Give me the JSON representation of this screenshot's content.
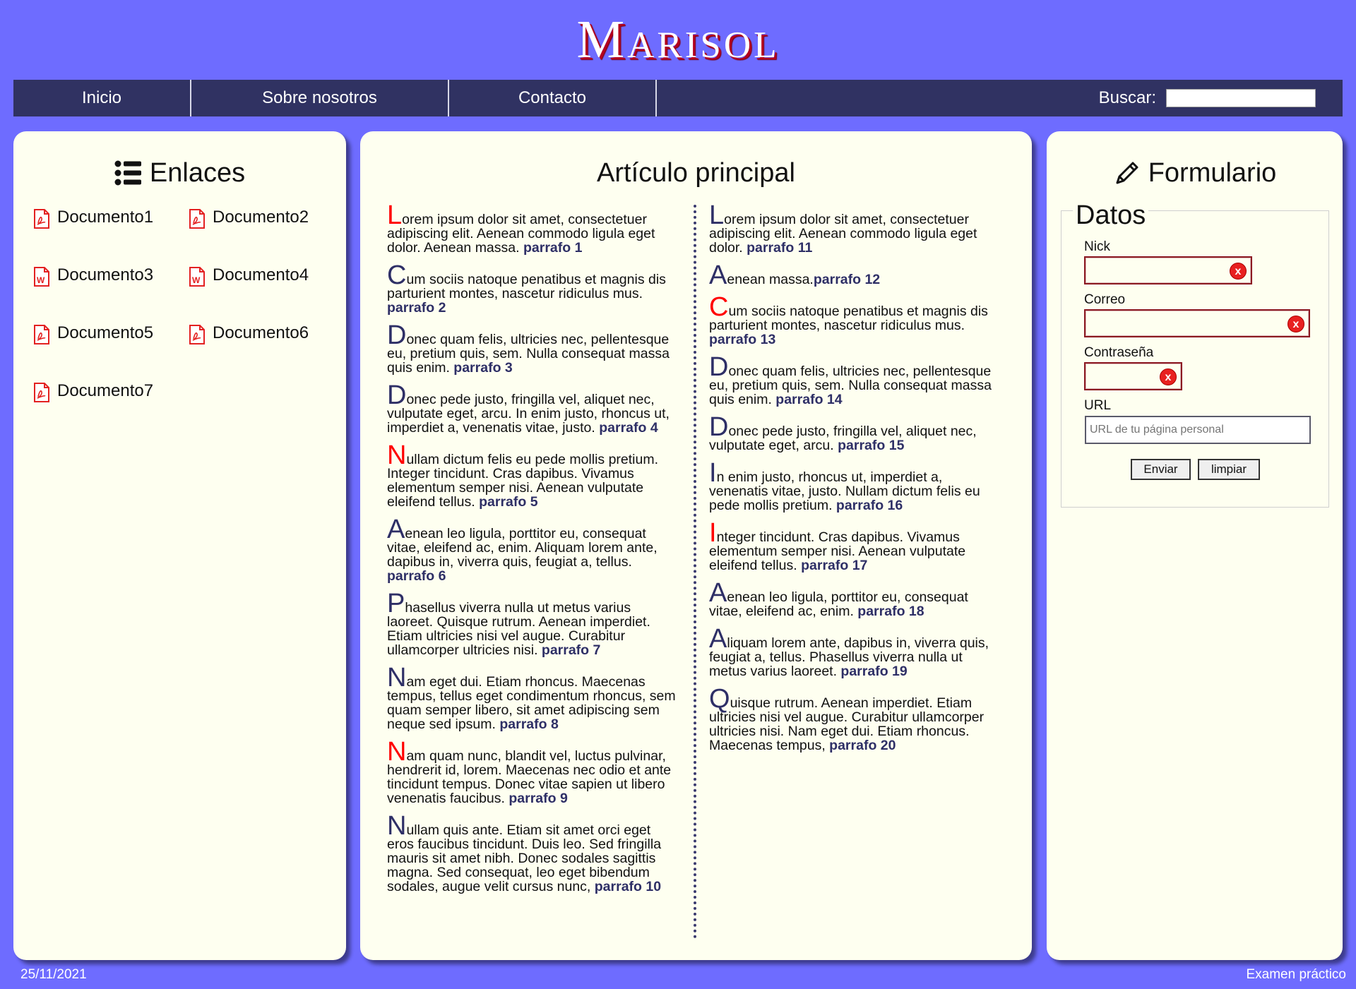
{
  "site": {
    "title": "Marisol"
  },
  "nav": {
    "items": [
      {
        "label": "Inicio"
      },
      {
        "label": "Sobre nosotros"
      },
      {
        "label": "Contacto"
      }
    ],
    "search_label": "Buscar:"
  },
  "links_panel": {
    "title": "Enlaces",
    "icon": "list-icon",
    "items": [
      {
        "label": "Documento1",
        "icon": "pdf-icon"
      },
      {
        "label": "Documento2",
        "icon": "pdf-icon"
      },
      {
        "label": "Documento3",
        "icon": "word-icon"
      },
      {
        "label": "Documento4",
        "icon": "word-icon"
      },
      {
        "label": "Documento5",
        "icon": "pdf-icon"
      },
      {
        "label": "Documento6",
        "icon": "pdf-icon"
      },
      {
        "label": "Documento7",
        "icon": "pdf-icon"
      }
    ]
  },
  "article": {
    "title": "Artículo principal",
    "paragraphs": [
      {
        "initial": "L",
        "red": true,
        "text": "orem ipsum dolor sit amet, consectetuer adipiscing elit. Aenean commodo ligula eget dolor. Aenean massa. ",
        "ref": "parrafo 1"
      },
      {
        "initial": "C",
        "red": false,
        "text": "um sociis natoque penatibus et magnis dis parturient montes, nascetur ridiculus mus. ",
        "ref": "parrafo 2"
      },
      {
        "initial": "D",
        "red": false,
        "text": "onec quam felis, ultricies nec, pellentesque eu, pretium quis, sem. Nulla consequat massa quis enim. ",
        "ref": "parrafo 3"
      },
      {
        "initial": "D",
        "red": false,
        "text": "onec pede justo, fringilla vel, aliquet nec, vulputate eget, arcu. In enim justo, rhoncus ut, imperdiet a, venenatis vitae, justo. ",
        "ref": "parrafo 4"
      },
      {
        "initial": "N",
        "red": true,
        "text": "ullam dictum felis eu pede mollis pretium. Integer tincidunt. Cras dapibus. Vivamus elementum semper nisi. Aenean vulputate eleifend tellus. ",
        "ref": "parrafo 5"
      },
      {
        "initial": "A",
        "red": false,
        "text": "enean leo ligula, porttitor eu, consequat vitae, eleifend ac, enim. Aliquam lorem ante, dapibus in, viverra quis, feugiat a, tellus. ",
        "ref": "parrafo 6"
      },
      {
        "initial": "P",
        "red": false,
        "text": "hasellus viverra nulla ut metus varius laoreet. Quisque rutrum. Aenean imperdiet. Etiam ultricies nisi vel augue. Curabitur ullamcorper ultricies nisi. ",
        "ref": "parrafo 7"
      },
      {
        "initial": "N",
        "red": false,
        "text": "am eget dui. Etiam rhoncus. Maecenas tempus, tellus eget condimentum rhoncus, sem quam semper libero, sit amet adipiscing sem neque sed ipsum. ",
        "ref": "parrafo 8"
      },
      {
        "initial": "N",
        "red": true,
        "text": "am quam nunc, blandit vel, luctus pulvinar, hendrerit id, lorem. Maecenas nec odio et ante tincidunt tempus. Donec vitae sapien ut libero venenatis faucibus. ",
        "ref": "parrafo 9"
      },
      {
        "initial": "N",
        "red": false,
        "text": "ullam quis ante. Etiam sit amet orci eget eros faucibus tincidunt. Duis leo. Sed fringilla mauris sit amet nibh. Donec sodales sagittis magna. Sed consequat, leo eget bibendum sodales, augue velit cursus nunc, ",
        "ref": "parrafo 10"
      },
      {
        "initial": "L",
        "red": false,
        "text": "orem ipsum dolor sit amet, consectetuer adipiscing elit. Aenean commodo ligula eget dolor. ",
        "ref": "parrafo 11"
      },
      {
        "initial": "A",
        "red": false,
        "text": "enean massa.",
        "ref": "parrafo 12"
      },
      {
        "initial": "C",
        "red": true,
        "text": "um sociis natoque penatibus et magnis dis parturient montes, nascetur ridiculus mus. ",
        "ref": "parrafo 13"
      },
      {
        "initial": "D",
        "red": false,
        "text": "onec quam felis, ultricies nec, pellentesque eu, pretium quis, sem. Nulla consequat massa quis enim. ",
        "ref": "parrafo 14"
      },
      {
        "initial": "D",
        "red": false,
        "text": "onec pede justo, fringilla vel, aliquet nec, vulputate eget, arcu. ",
        "ref": "parrafo 15"
      },
      {
        "initial": "I",
        "red": false,
        "text": "n enim justo, rhoncus ut, imperdiet a, venenatis vitae, justo. Nullam dictum felis eu pede mollis pretium. ",
        "ref": "parrafo 16"
      },
      {
        "initial": "I",
        "red": true,
        "text": "nteger tincidunt. Cras dapibus. Vivamus elementum semper nisi. Aenean vulputate eleifend tellus. ",
        "ref": "parrafo 17"
      },
      {
        "initial": "A",
        "red": false,
        "text": "enean leo ligula, porttitor eu, consequat vitae, eleifend ac, enim. ",
        "ref": "parrafo 18"
      },
      {
        "initial": "A",
        "red": false,
        "text": "liquam lorem ante, dapibus in, viverra quis, feugiat a, tellus. Phasellus viverra nulla ut metus varius laoreet. ",
        "ref": "parrafo 19"
      },
      {
        "initial": "Q",
        "red": false,
        "text": "uisque rutrum. Aenean imperdiet. Etiam ultricies nisi vel augue. Curabitur ullamcorper ultricies nisi. Nam eget dui. Etiam rhoncus. Maecenas tempus, ",
        "ref": "parrafo 20"
      }
    ]
  },
  "form_panel": {
    "title": "Formulario",
    "icon": "pencil-icon",
    "legend": "Datos",
    "fields": {
      "nick": {
        "label": "Nick"
      },
      "correo": {
        "label": "Correo"
      },
      "contrasena": {
        "label": "Contraseña"
      },
      "url": {
        "label": "URL",
        "placeholder": "URL de tu página personal"
      }
    },
    "error_icon": "error-x-icon",
    "buttons": {
      "submit": "Enviar",
      "reset": "limpiar"
    }
  },
  "footer": {
    "date": "25/11/2021",
    "note": "Examen práctico"
  },
  "colors": {
    "background": "#6e6cff",
    "nav": "#303262",
    "panel": "#fefff0",
    "accent_red": "#ff0000",
    "ref": "#2e2f66"
  }
}
